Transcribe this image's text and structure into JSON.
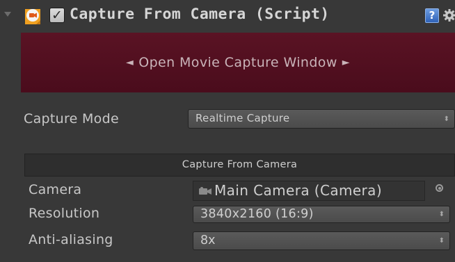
{
  "component": {
    "title": "Capture From Camera (Script)",
    "enabled_check": "✓",
    "help_glyph": "?",
    "icons": [
      "foldout-arrow-icon",
      "movie-capture-script-icon",
      "help-icon",
      "gear-icon"
    ]
  },
  "banner": {
    "left_arrow": "◄",
    "label": "Open Movie Capture Window",
    "right_arrow": "►",
    "color": "#4f0f1f"
  },
  "capture_mode": {
    "label": "Capture Mode",
    "value": "Realtime Capture"
  },
  "section": {
    "title": "Capture From Camera"
  },
  "camera": {
    "label": "Camera",
    "value": "Main Camera (Camera)"
  },
  "resolution": {
    "label": "Resolution",
    "value": "3840x2160 (16:9)"
  },
  "anti_aliasing": {
    "label": "Anti-aliasing",
    "value": "8x"
  },
  "popup_arrows": "⬍"
}
